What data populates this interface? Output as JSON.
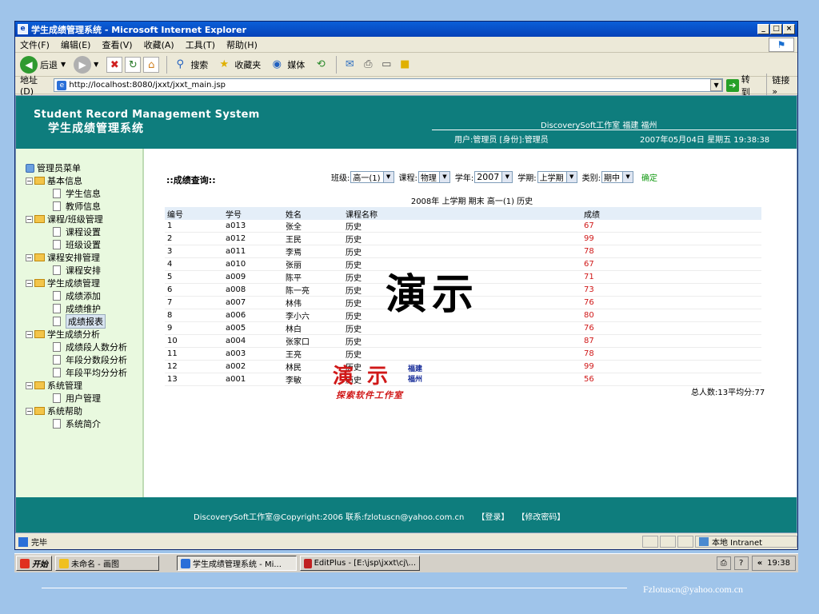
{
  "window": {
    "title": "学生成绩管理系统 - Microsoft Internet Explorer",
    "min": "_",
    "max": "□",
    "close": "×"
  },
  "menu": [
    "文件(F)",
    "编辑(E)",
    "查看(V)",
    "收藏(A)",
    "工具(T)",
    "帮助(H)"
  ],
  "toolbar": {
    "back": "后退",
    "search": "搜索",
    "favorites": "收藏夹",
    "media": "媒体"
  },
  "address": {
    "label": "地址(D)",
    "url": "http://localhost:8080/jxxt/jxxt_main.jsp",
    "go": "转到",
    "links": "链接 »"
  },
  "header": {
    "title_en": "Student Record Management System",
    "title_cn": "学生成绩管理系统",
    "studio": "DiscoverySoft工作室 福建 福州",
    "user": "用户:管理员 [身份]:管理员",
    "datetime": "2007年05月04日 星期五 19:38:38"
  },
  "sidebar": {
    "root": "管理员菜单",
    "groups": [
      {
        "label": "基本信息",
        "items": [
          "学生信息",
          "教师信息"
        ]
      },
      {
        "label": "课程/班级管理",
        "items": [
          "课程设置",
          "班级设置"
        ]
      },
      {
        "label": "课程安排管理",
        "items": [
          "课程安排"
        ]
      },
      {
        "label": "学生成绩管理",
        "items": [
          "成绩添加",
          "成绩维护",
          "成绩报表"
        ]
      },
      {
        "label": "学生成绩分析",
        "items": [
          "成绩段人数分析",
          "年段分数段分析",
          "年段平均分分析"
        ]
      },
      {
        "label": "系统管理",
        "items": [
          "用户管理"
        ]
      },
      {
        "label": "系统帮助",
        "items": [
          "系统简介"
        ]
      }
    ],
    "selected": "成绩报表"
  },
  "query": {
    "title": "::成绩查询::",
    "class_label": "班级:",
    "class_value": "高一(1)",
    "course_label": "课程:",
    "course_value": "物理",
    "year_label": "学年:",
    "year_value": "2007",
    "term_label": "学期:",
    "term_value": "上学期",
    "type_label": "类别:",
    "type_value": "期中",
    "confirm": "确定"
  },
  "report": {
    "caption": "2008年 上学期 期末 高一(1) 历史",
    "columns": [
      "编号",
      "学号",
      "姓名",
      "课程名称",
      "成绩"
    ],
    "rows": [
      [
        "1",
        "a013",
        "张全",
        "历史",
        "67"
      ],
      [
        "2",
        "a012",
        "王民",
        "历史",
        "99"
      ],
      [
        "3",
        "a011",
        "李焉",
        "历史",
        "78"
      ],
      [
        "4",
        "a010",
        "张丽",
        "历史",
        "67"
      ],
      [
        "5",
        "a009",
        "陈平",
        "历史",
        "71"
      ],
      [
        "6",
        "a008",
        "陈一亮",
        "历史",
        "73"
      ],
      [
        "7",
        "a007",
        "林伟",
        "历史",
        "76"
      ],
      [
        "8",
        "a006",
        "李小六",
        "历史",
        "80"
      ],
      [
        "9",
        "a005",
        "林白",
        "历史",
        "76"
      ],
      [
        "10",
        "a004",
        "张家口",
        "历史",
        "87"
      ],
      [
        "11",
        "a003",
        "王亮",
        "历史",
        "78"
      ],
      [
        "12",
        "a002",
        "林民",
        "历史",
        "99"
      ],
      [
        "13",
        "a001",
        "李敏",
        "历史",
        "56"
      ]
    ],
    "summary": "总人数:13平均分:77"
  },
  "watermark": {
    "big": "演示",
    "small": "演 示",
    "side1": "福建",
    "side2": "福州",
    "line": "探索软件工作室"
  },
  "footer": {
    "copyright": "DiscoverySoft工作室@Copyright:2006 联系:fzlotuscn@yahoo.com.cn",
    "login": "【登录】",
    "change_pw": "【修改密码】"
  },
  "status": {
    "text": "完毕",
    "zone": "本地 Intranet"
  },
  "taskbar": {
    "start": "开始",
    "paint": "未命名 - 画图",
    "ie": "学生成绩管理系统 - Mi...",
    "editplus": "EditPlus - [E:\\jsp\\jxxt\\cj\\...",
    "clock": "19:38",
    "chevron": "«"
  },
  "slide": {
    "email": "Fzlotuscn@yahoo.com.cn"
  }
}
